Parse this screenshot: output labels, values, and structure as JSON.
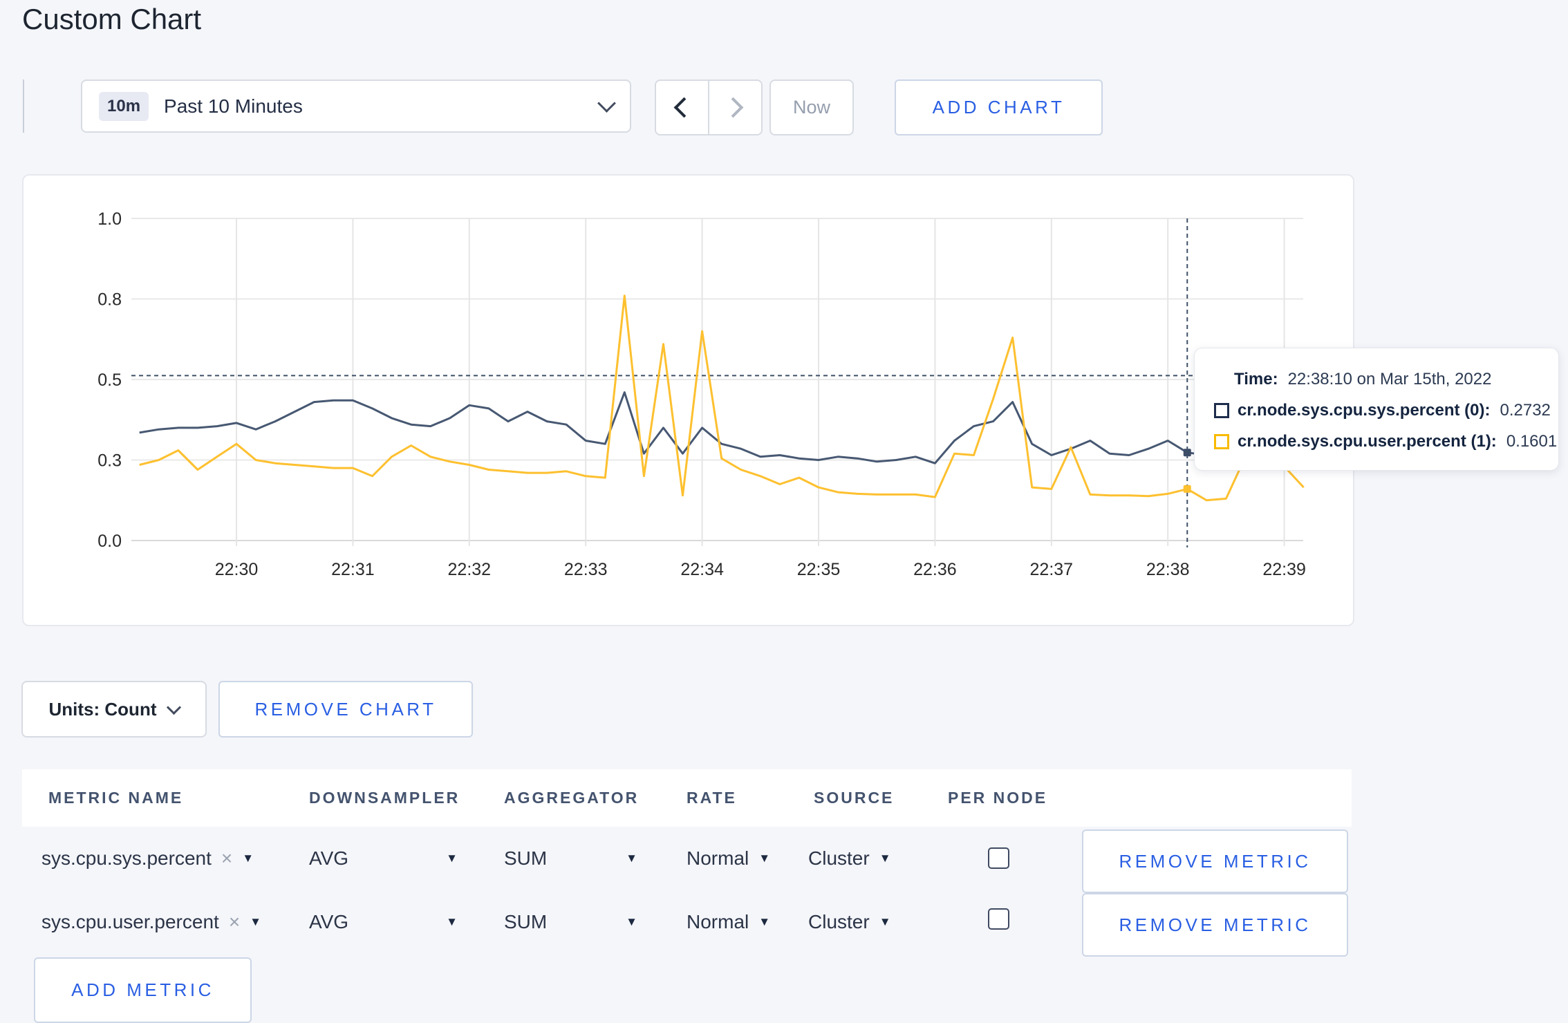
{
  "page": {
    "title": "Custom Chart"
  },
  "toolbar": {
    "time_range": {
      "badge": "10m",
      "label": "Past 10 Minutes"
    },
    "now_label": "Now",
    "add_chart_label": "ADD CHART"
  },
  "chart_data": {
    "type": "line",
    "title": "",
    "xlabel": "",
    "ylabel": "",
    "ylim": [
      0,
      1
    ],
    "grid": true,
    "x_tick_labels": [
      "22:30",
      "22:31",
      "22:32",
      "22:33",
      "22:34",
      "22:35",
      "22:36",
      "22:37",
      "22:38",
      "22:39"
    ],
    "y_tick_labels": [
      "0.0",
      "0.3",
      "0.5",
      "0.8",
      "1.0"
    ],
    "y_tick_values": [
      0,
      0.25,
      0.5,
      0.75,
      1.0
    ],
    "x_start": "22:29:10",
    "x_step_seconds": 10,
    "x_range": [
      "22:29:10",
      "22:39:10"
    ],
    "series": [
      {
        "name": "cr.node.sys.cpu.sys.percent (0)",
        "color": "#475872",
        "values": [
          0.335,
          0.345,
          0.35,
          0.35,
          0.355,
          0.365,
          0.345,
          0.37,
          0.4,
          0.43,
          0.435,
          0.435,
          0.41,
          0.38,
          0.36,
          0.355,
          0.38,
          0.42,
          0.41,
          0.37,
          0.4,
          0.37,
          0.36,
          0.31,
          0.3,
          0.46,
          0.27,
          0.35,
          0.27,
          0.35,
          0.3,
          0.285,
          0.26,
          0.265,
          0.255,
          0.25,
          0.26,
          0.255,
          0.245,
          0.25,
          0.26,
          0.24,
          0.31,
          0.355,
          0.37,
          0.43,
          0.3,
          0.265,
          0.285,
          0.31,
          0.27,
          0.265,
          0.285,
          0.31,
          0.2732,
          0.265,
          0.27,
          0.29,
          0.3,
          0.295,
          0.31
        ]
      },
      {
        "name": "cr.node.sys.cpu.user.percent (1)",
        "color": "#fdc02f",
        "values": [
          0.235,
          0.25,
          0.28,
          0.22,
          0.26,
          0.3,
          0.25,
          0.24,
          0.235,
          0.23,
          0.225,
          0.225,
          0.2,
          0.26,
          0.295,
          0.26,
          0.245,
          0.235,
          0.22,
          0.215,
          0.21,
          0.21,
          0.215,
          0.2,
          0.195,
          0.76,
          0.2,
          0.61,
          0.14,
          0.65,
          0.255,
          0.22,
          0.2,
          0.175,
          0.195,
          0.165,
          0.15,
          0.145,
          0.143,
          0.143,
          0.143,
          0.135,
          0.27,
          0.265,
          0.44,
          0.63,
          0.165,
          0.16,
          0.29,
          0.143,
          0.14,
          0.14,
          0.138,
          0.145,
          0.1601,
          0.125,
          0.13,
          0.26,
          0.33,
          0.23,
          0.165
        ]
      }
    ],
    "crosshair": {
      "time": "22:38:10",
      "y_frac": 0.512
    },
    "legend_position": "tooltip"
  },
  "tooltip": {
    "time_label": "Time:",
    "time_value": "22:38:10 on Mar 15th, 2022",
    "rows": [
      {
        "label": "cr.node.sys.cpu.sys.percent (0):",
        "value": "0.2732",
        "square_color": "#1e2d4d"
      },
      {
        "label": "cr.node.sys.cpu.user.percent (1):",
        "value": "0.1601",
        "square_color": "#f8ba00"
      }
    ]
  },
  "chart_controls": {
    "units_label": "Units: Count",
    "remove_chart_label": "REMOVE CHART"
  },
  "metrics_table": {
    "headers": [
      "METRIC NAME",
      "DOWNSAMPLER",
      "AGGREGATOR",
      "RATE",
      "SOURCE",
      "PER NODE"
    ],
    "rows": [
      {
        "metric": "sys.cpu.sys.percent",
        "downsampler": "AVG",
        "aggregator": "SUM",
        "rate": "Normal",
        "source": "Cluster",
        "per_node_checked": false,
        "remove_label": "REMOVE METRIC"
      },
      {
        "metric": "sys.cpu.user.percent",
        "downsampler": "AVG",
        "aggregator": "SUM",
        "rate": "Normal",
        "source": "Cluster",
        "per_node_checked": false,
        "remove_label": "REMOVE METRIC"
      }
    ],
    "add_metric_label": "ADD METRIC",
    "clear_icon": "×",
    "dropdown_icon": "▼"
  }
}
